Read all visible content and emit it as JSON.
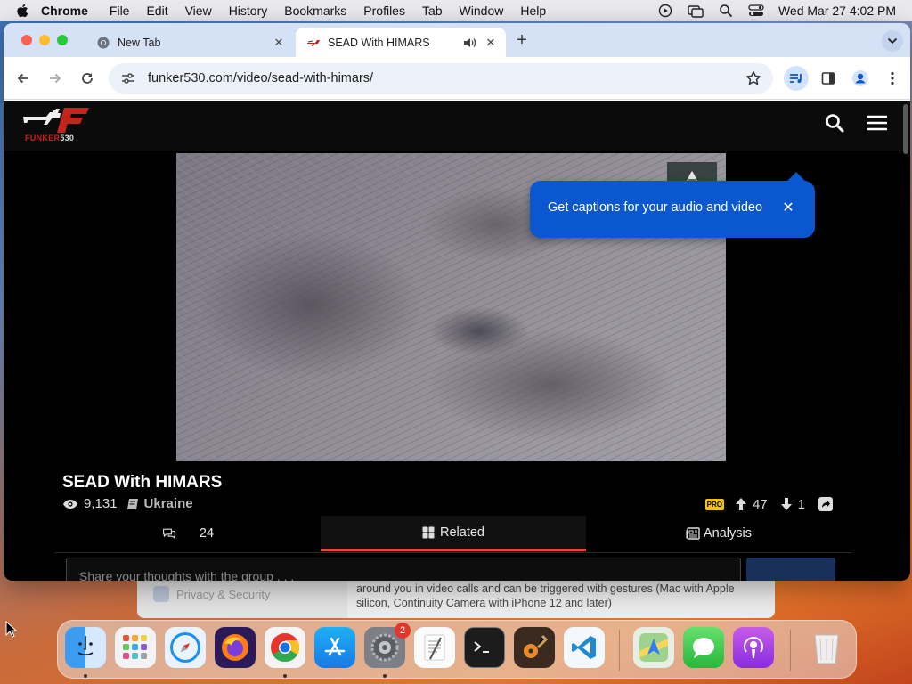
{
  "menubar": {
    "app_name": "Chrome",
    "items": [
      "File",
      "Edit",
      "View",
      "History",
      "Bookmarks",
      "Profiles",
      "Tab",
      "Window",
      "Help"
    ],
    "clock": "Wed Mar 27  4:02 PM"
  },
  "tabs": [
    {
      "title": "New Tab",
      "active": false
    },
    {
      "title": "SEAD With HIMARS",
      "active": true,
      "audio": true
    }
  ],
  "toolbar": {
    "url": "funker530.com/video/sead-with-himars/"
  },
  "site": {
    "logo_text": "FUNKER",
    "logo_number": "530"
  },
  "tooltip": {
    "text": "Get captions for your audio and video"
  },
  "video": {
    "title": "SEAD With HIMARS",
    "views": "9,131",
    "category": "Ukraine",
    "badge": "PRO",
    "upvotes": "47",
    "downvotes": "1"
  },
  "page_tabs": {
    "comments_count": "24",
    "related": "Related",
    "analysis": "Analysis"
  },
  "comment": {
    "placeholder": "Share your thoughts with the group . . ."
  },
  "background_window": {
    "sidebar_item": "Privacy & Security",
    "description": "around you in video calls and can be triggered with gestures (Mac with Apple silicon, Continuity Camera with iPhone 12 and later)"
  },
  "dock": {
    "apps": [
      "Finder",
      "Launchpad",
      "Safari",
      "Firefox",
      "Chrome",
      "App Store",
      "System Settings",
      "TextEdit",
      "Terminal",
      "GarageBand",
      "VS Code",
      "Maps",
      "Messages",
      "Podcasts",
      "Trash"
    ],
    "settings_badge": "2"
  },
  "colors": {
    "accent_tab_underline": "#e5483b",
    "tooltip_blue": "#0b57d0",
    "pro_badge": "#f4c20d"
  }
}
